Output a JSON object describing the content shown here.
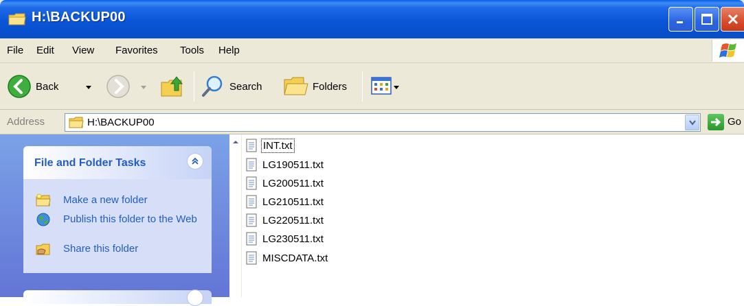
{
  "window": {
    "title": "H:\\BACKUP00"
  },
  "menu": [
    "File",
    "Edit",
    "View",
    "Favorites",
    "Tools",
    "Help"
  ],
  "toolbar": {
    "back_label": "Back",
    "search_label": "Search",
    "folders_label": "Folders"
  },
  "address": {
    "label": "Address",
    "value": "H:\\BACKUP00",
    "go_label": "Go"
  },
  "task_pane": {
    "title": "File and Folder Tasks",
    "links": [
      {
        "label": "Make a new folder",
        "icon": "new-folder-icon"
      },
      {
        "label": "Publish this folder to the Web",
        "icon": "globe-icon"
      },
      {
        "label": "Share this folder",
        "icon": "share-folder-icon"
      }
    ]
  },
  "files": [
    {
      "name": "INT.txt",
      "focused": true
    },
    {
      "name": "LG190511.txt",
      "focused": false
    },
    {
      "name": "LG200511.txt",
      "focused": false
    },
    {
      "name": "LG210511.txt",
      "focused": false
    },
    {
      "name": "LG220511.txt",
      "focused": false
    },
    {
      "name": "LG230511.txt",
      "focused": false
    },
    {
      "name": "MISCDATA.txt",
      "focused": false
    }
  ],
  "colors": {
    "titlebar": "#0a55d8",
    "link": "#215dc6",
    "pane_bg": "#7ba2e7",
    "window_bg": "#ece9d8"
  }
}
